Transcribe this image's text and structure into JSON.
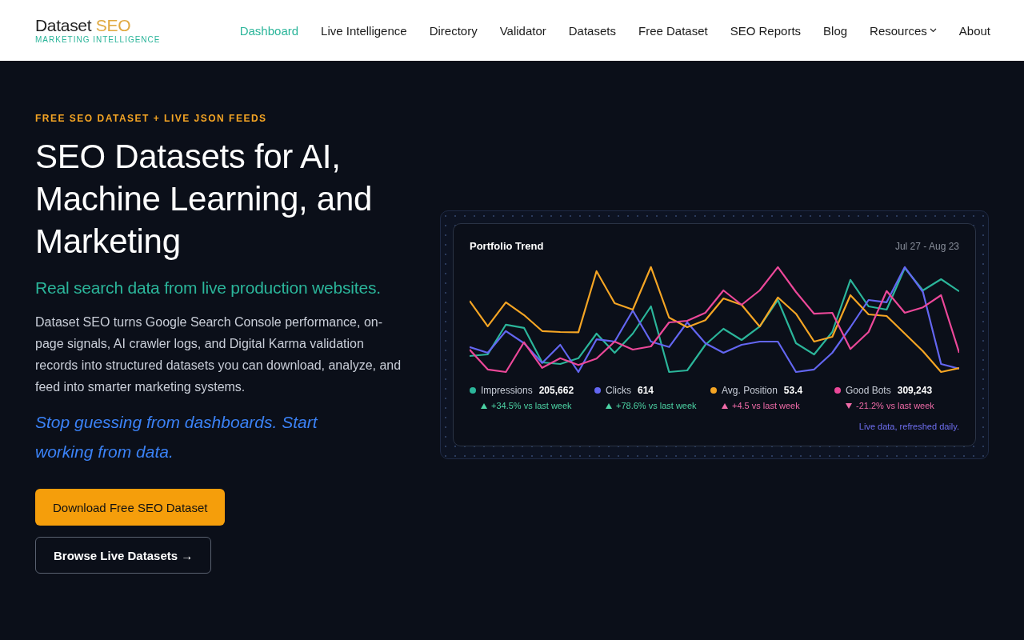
{
  "header": {
    "logo": {
      "word": "Dataset",
      "accent": "SEO",
      "tagline": "MARKETING INTELLIGENCE"
    },
    "nav": [
      {
        "label": "Dashboard",
        "selected": true,
        "dropdown": false
      },
      {
        "label": "Live Intelligence",
        "selected": false,
        "dropdown": false
      },
      {
        "label": "Directory",
        "selected": false,
        "dropdown": false
      },
      {
        "label": "Validator",
        "selected": false,
        "dropdown": false
      },
      {
        "label": "Datasets",
        "selected": false,
        "dropdown": false
      },
      {
        "label": "Free Dataset",
        "selected": false,
        "dropdown": false
      },
      {
        "label": "SEO Reports",
        "selected": false,
        "dropdown": false
      },
      {
        "label": "Blog",
        "selected": false,
        "dropdown": false
      },
      {
        "label": "Resources",
        "selected": false,
        "dropdown": true
      },
      {
        "label": "About",
        "selected": false,
        "dropdown": false
      }
    ]
  },
  "hero": {
    "eyebrow": "FREE SEO DATASET + LIVE JSON FEEDS",
    "title": "SEO Datasets for AI, Machine Learning, and Marketing",
    "subtitle": "Real search data from live production websites.",
    "body": "Dataset SEO turns Google Search Console performance, on-page signals, AI crawler logs, and Digital Karma validation records into structured datasets you can download, analyze, and feed into smarter marketing systems.",
    "callout": "Stop guessing from dashboards. Start working from data.",
    "buttons": [
      {
        "label": "Download Free SEO Dataset",
        "kind": "primary"
      },
      {
        "label": "Browse Live Datasets →",
        "kind": "outline"
      }
    ]
  },
  "trend_card": {
    "title": "Portfolio Trend",
    "range": "Jul 27 - Aug 23",
    "metrics": [
      {
        "name": "Impressions",
        "value": "205,662",
        "color": "#2bb59a",
        "change": "+34.5% vs last week",
        "rising": true,
        "favorable": true
      },
      {
        "name": "Clicks",
        "value": "614",
        "color": "#6366f1",
        "change": "+78.6% vs last week",
        "rising": true,
        "favorable": true
      },
      {
        "name": "Avg. Position",
        "value": "53.4",
        "color": "#f5a524",
        "change": "+4.5 vs last week",
        "rising": true,
        "favorable": false
      },
      {
        "name": "Good Bots",
        "value": "309,243",
        "color": "#ec4899",
        "change": "-21.2% vs last week",
        "rising": false,
        "favorable": false
      }
    ],
    "footnote": "Live data, refreshed daily."
  }
}
